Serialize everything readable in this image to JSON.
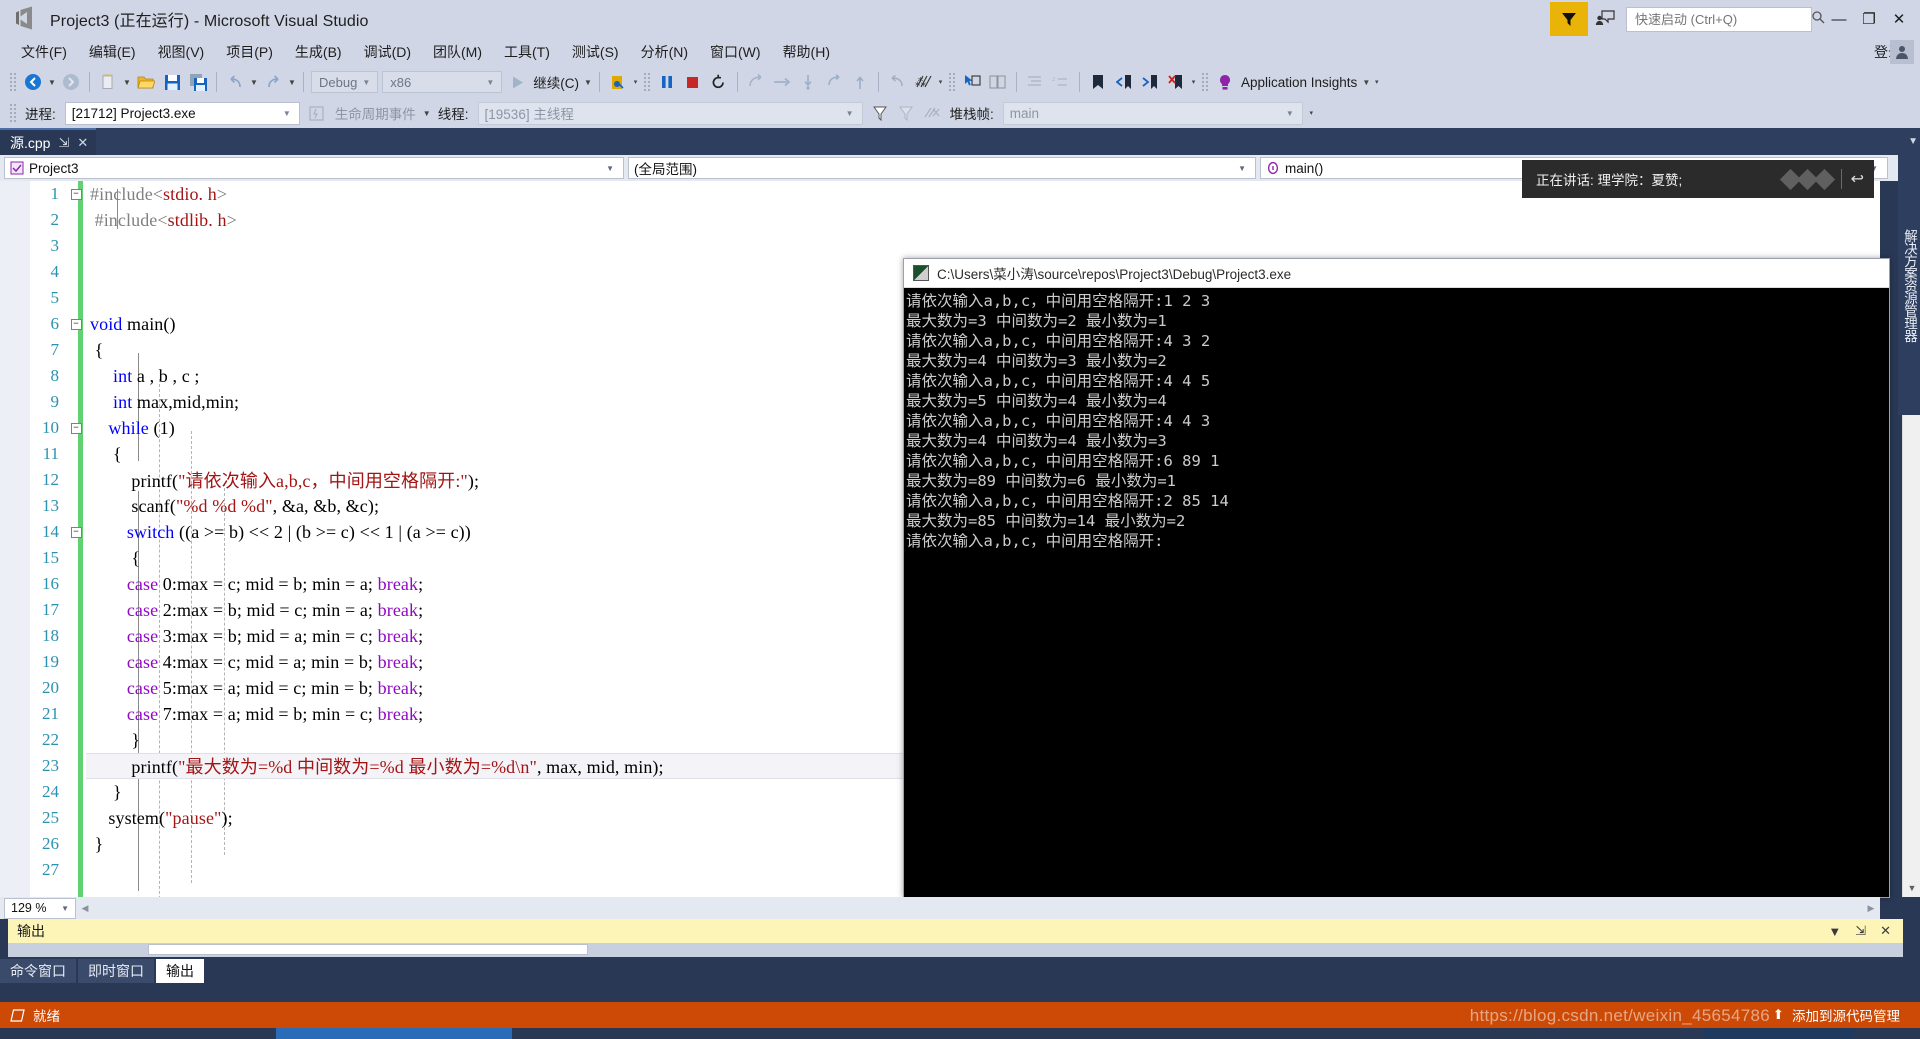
{
  "window": {
    "title": "Project3 (正在运行) - Microsoft Visual Studio",
    "logo_icon": "visual-studio-logo",
    "minimize_icon": "—",
    "maximize_icon": "❐",
    "close_icon": "✕"
  },
  "quick_launch": {
    "placeholder": "快速启动 (Ctrl+Q)",
    "value": "",
    "search_icon": "search-icon"
  },
  "feedback": {
    "filter_icon": "feedback-funnel-icon",
    "notify_icon": "send-feedback-icon"
  },
  "menu": {
    "items": [
      "文件(F)",
      "编辑(E)",
      "视图(V)",
      "项目(P)",
      "生成(B)",
      "调试(D)",
      "团队(M)",
      "工具(T)",
      "测试(S)",
      "分析(N)",
      "窗口(W)",
      "帮助(H)"
    ],
    "login_label": "登录",
    "account_icon": "account-avatar-icon"
  },
  "toolbar": {
    "nav_back_icon": "navigate-back-icon",
    "nav_forward_icon": "navigate-forward-icon",
    "new_item_icon": "new-item-icon",
    "open_icon": "open-folder-icon",
    "save_icon": "save-icon",
    "save_all_icon": "save-all-icon",
    "undo_icon": "undo-icon",
    "redo_icon": "redo-icon",
    "config_value": "Debug",
    "platform_value": "x86",
    "run_icon": "start-debug-icon",
    "continue_label": "继续(C)",
    "breakpoint_icon": "breakpoint-icon",
    "pause_icon": "pause-icon",
    "stop_icon": "stop-icon",
    "restart_icon": "restart-icon",
    "show_next_statement_icon": "show-next-statement-icon",
    "step_over_icon": "step-over-icon",
    "step_into_icon": "step-into-icon",
    "step_out_icon": "step-out-icon",
    "step_up_icon": "step-up-icon",
    "revert_icon": "revert-icon",
    "hex_icon": "hexadecimal-display-icon",
    "pointer_icon": "pointer-select-icon",
    "compare_icon": "compare-icon",
    "indent_icon": "indent-icon",
    "list_icon": "list-icon",
    "bookmark_icon": "bookmark-icon",
    "prev_bookmark_icon": "previous-bookmark-icon",
    "next_bookmark_icon": "next-bookmark-icon",
    "clear_bookmarks_icon": "clear-bookmarks-icon",
    "insights_icon": "application-insights-icon",
    "insights_label": "Application Insights"
  },
  "debugbar": {
    "process_label": "进程:",
    "process_value": "[21712] Project3.exe",
    "lifecycle_icon": "lifecycle-events-icon",
    "lifecycle_label": "生命周期事件",
    "thread_label": "线程:",
    "thread_value": "[19536] 主线程",
    "filter_icon": "thread-filter-icon",
    "filter2_icon": "thread-filter-clear-icon",
    "flag_icon": "flag-icon",
    "stackframe_label": "堆栈帧:",
    "stackframe_value": "main"
  },
  "document_tab": {
    "label": "源.cpp",
    "pin_icon": "pin-icon",
    "close_icon": "close-icon"
  },
  "navbar": {
    "project_icon": "project-icon",
    "project_value": "Project3",
    "scope_value": "(全局范围)",
    "member_icon": "method-icon",
    "member_value": "main()"
  },
  "editor": {
    "zoom_level": "129 %",
    "lines": [
      {
        "n": "1",
        "fold": "minus",
        "text": "#include<stdio. h>",
        "kind": "include"
      },
      {
        "n": "2",
        "fold": "bar",
        "text": "#include<stdlib. h>",
        "kind": "include"
      },
      {
        "n": "3",
        "fold": "",
        "text": ""
      },
      {
        "n": "4",
        "fold": "",
        "text": ""
      },
      {
        "n": "5",
        "fold": "",
        "text": ""
      },
      {
        "n": "6",
        "fold": "minus",
        "text": "void main()",
        "kind": "void-main"
      },
      {
        "n": "7",
        "fold": "",
        "text": "{",
        "indent": 1
      },
      {
        "n": "8",
        "fold": "",
        "text": "int a , b , c ;",
        "kind": "int-decl",
        "indent": 2
      },
      {
        "n": "9",
        "fold": "",
        "text": "int max,mid,min;",
        "kind": "int-decl2",
        "indent": 2
      },
      {
        "n": "10",
        "fold": "minus",
        "text": "while (1)",
        "kind": "while",
        "indent": 2
      },
      {
        "n": "11",
        "fold": "",
        "text": "{",
        "indent": 3
      },
      {
        "n": "12",
        "fold": "",
        "text": "printf(\"请依次输入a,b,c，中间用空格隔开:\");",
        "kind": "printf1",
        "indent": 4
      },
      {
        "n": "13",
        "fold": "",
        "text": "scanf(\"%d %d %d\", &a, &b, &c);",
        "kind": "scanf",
        "indent": 4
      },
      {
        "n": "14",
        "fold": "minus",
        "text": "switch ((a >= b) << 2 | (b >= c) << 1 | (a >= c))",
        "kind": "switch",
        "indent": 4
      },
      {
        "n": "15",
        "fold": "",
        "text": "{",
        "indent": 5
      },
      {
        "n": "16",
        "fold": "",
        "text": "case 0:max = c; mid = b; min = a; break;",
        "kind": "case",
        "indent": 4
      },
      {
        "n": "17",
        "fold": "",
        "text": "case 2:max = b; mid = c; min = a; break;",
        "kind": "case",
        "indent": 4
      },
      {
        "n": "18",
        "fold": "",
        "text": "case 3:max = b; mid = a; min = c; break;",
        "kind": "case",
        "indent": 4
      },
      {
        "n": "19",
        "fold": "",
        "text": "case 4:max = c; mid = a; min = b; break;",
        "kind": "case",
        "indent": 4
      },
      {
        "n": "20",
        "fold": "",
        "text": "case 5:max = a; mid = c; min = b; break;",
        "kind": "case",
        "indent": 4
      },
      {
        "n": "21",
        "fold": "",
        "text": "case 7:max = a; mid = b; min = c; break;",
        "kind": "case",
        "indent": 4
      },
      {
        "n": "22",
        "fold": "",
        "text": "}",
        "indent": 5
      },
      {
        "n": "23",
        "fold": "",
        "text": "printf(\"最大数为=%d 中间数为=%d 最小数为=%d\\n\", max, mid, min);",
        "kind": "printf2",
        "indent": 4,
        "current": true
      },
      {
        "n": "24",
        "fold": "",
        "text": "}",
        "indent": 3
      },
      {
        "n": "25",
        "fold": "",
        "text": "system(\"pause\");",
        "kind": "system",
        "indent": 2
      },
      {
        "n": "26",
        "fold": "",
        "text": "}",
        "indent": 1
      },
      {
        "n": "27",
        "fold": "",
        "text": ""
      }
    ]
  },
  "console": {
    "title": "C:\\Users\\菜小涛\\source\\repos\\Project3\\Debug\\Project3.exe",
    "icon": "console-window-icon",
    "lines": [
      "请依次输入a,b,c，中间用空格隔开:1 2 3",
      "最大数为=3 中间数为=2 最小数为=1",
      "请依次输入a,b,c，中间用空格隔开:4 3 2",
      "最大数为=4 中间数为=3 最小数为=2",
      "请依次输入a,b,c，中间用空格隔开:4 4 5",
      "最大数为=5 中间数为=4 最小数为=4",
      "请依次输入a,b,c，中间用空格隔开:4 4 3",
      "最大数为=4 中间数为=4 最小数为=3",
      "请依次输入a,b,c，中间用空格隔开:6 89 1",
      "最大数为=89 中间数为=6 最小数为=1",
      "请依次输入a,b,c，中间用空格隔开:2 85 14",
      "最大数为=85 中间数为=14 最小数为=2",
      "请依次输入a,b,c，中间用空格隔开:"
    ]
  },
  "toast": {
    "text": "正在讲话: 理学院：夏赞;",
    "reply_icon": "reply-arrow-icon",
    "diamond_icon": "diamond-logo-icon"
  },
  "solution_explorer_tab": {
    "label": "解决方案资源管理器",
    "caret_icon": "chevron-down-icon"
  },
  "output_pane": {
    "title": "输出",
    "dropdown_icon": "chevron-down-icon",
    "pin_icon": "pin-icon",
    "close_icon": "close-icon",
    "tabs": [
      {
        "label": "命令窗口",
        "active": false
      },
      {
        "label": "即时窗口",
        "active": false
      },
      {
        "label": "输出",
        "active": true
      }
    ]
  },
  "status_bar": {
    "icon": "source-control-icon",
    "text": "就绪",
    "right_text": "添加到源代码管理",
    "up_arrow_icon": "arrow-up-icon",
    "color": "#cc4a06"
  },
  "watermark": {
    "text": "https://blog.csdn.net/weixin_45654786"
  },
  "colors": {
    "chrome": "#d0d6e5",
    "accent_blue": "#2b91af",
    "keyword_blue": "#0000ff",
    "string_red": "#a31515",
    "control_purple": "#8f08c4",
    "changebar_green": "#62d172",
    "status_orange": "#cc4a06",
    "shell_dark": "#293955",
    "output_yellow": "#fdf5b8",
    "feedback_gold": "#eab308"
  }
}
